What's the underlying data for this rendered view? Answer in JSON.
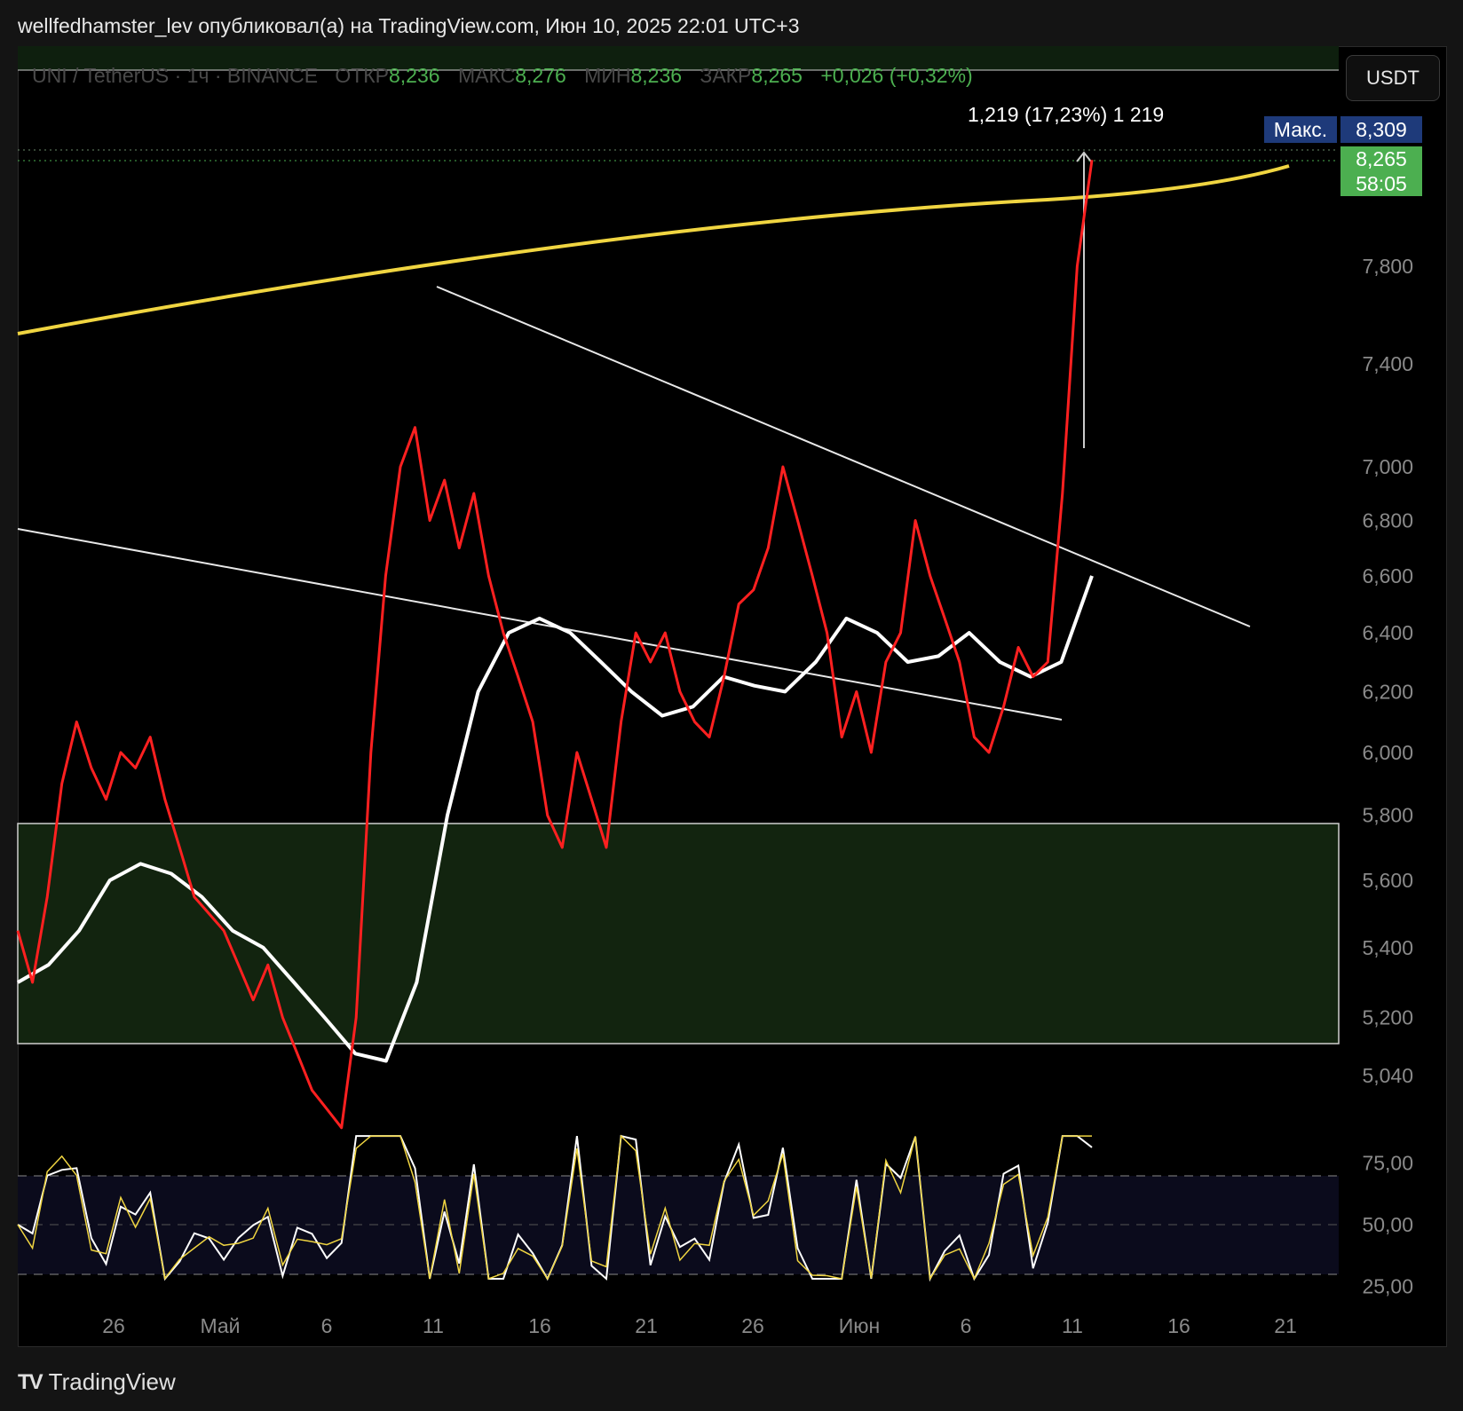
{
  "header": {
    "text": "wellfedhamster_lev опубликовал(а) на TradingView.com, Июн 10, 2025 22:01 UTC+3"
  },
  "legend": {
    "symbol": "UNI / TetherUS · 1ч · BINANCE",
    "open_label": "ОТКР",
    "open": "8,236",
    "high_label": "МАКС",
    "high": "8,276",
    "low_label": "МИН",
    "low": "8,236",
    "close_label": "ЗАКР",
    "close": "8,265",
    "change": "+0,026 (+0,32%)"
  },
  "currency_button": "USDT",
  "measure_label": "1,219 (17,23%) 1 219",
  "price_tags": {
    "max_label": "Макс.",
    "max_value": "8,309",
    "last_value": "8,265",
    "countdown": "58:05"
  },
  "footer": {
    "brand": "TradingView"
  },
  "colors": {
    "up": "#4caf50",
    "tag_blue": "#1e3a7a",
    "tag_green": "#4caf50",
    "yellow_line": "#f0d541",
    "fast_ma": "#ff2020",
    "slow_ma": "#ffffff"
  },
  "chart_data": {
    "type": "line",
    "price_axis": {
      "ticks": [
        "7,800",
        "7,400",
        "7,000",
        "6,800",
        "6,600",
        "6,400",
        "6,200",
        "6,000",
        "5,800",
        "5,600",
        "5,400",
        "5,200",
        "5,040"
      ],
      "scale": "log"
    },
    "rsi_axis": {
      "ticks": [
        "75,00",
        "50,00",
        "25,00"
      ],
      "band": [
        30,
        70
      ]
    },
    "x_ticks": [
      "26",
      "Май",
      "6",
      "11",
      "16",
      "21",
      "26",
      "Июн",
      "6",
      "11",
      "16",
      "21"
    ],
    "series": [
      {
        "values": [
          5.45,
          5.3,
          5.55,
          5.9,
          6.1,
          5.95,
          5.85,
          6.0,
          5.95,
          6.05,
          5.85,
          5.7,
          5.55,
          5.5,
          5.45,
          5.35,
          5.25,
          5.35,
          5.2,
          5.1,
          5.0,
          4.95,
          4.9,
          5.2,
          6.0,
          6.6,
          7.0,
          7.15,
          6.8,
          6.95,
          6.7,
          6.9,
          6.6,
          6.4,
          6.25,
          6.1,
          5.8,
          5.7,
          6.0,
          5.85,
          5.7,
          6.1,
          6.4,
          6.3,
          6.4,
          6.2,
          6.1,
          6.05,
          6.25,
          6.5,
          6.55,
          6.7,
          7.0,
          6.8,
          6.6,
          6.4,
          6.05,
          6.2,
          6.0,
          6.3,
          6.4,
          6.8,
          6.6,
          6.45,
          6.3,
          6.05,
          6.0,
          6.15,
          6.35,
          6.25,
          6.3,
          6.9,
          7.8,
          8.26
        ]
      },
      {
        "values": [
          5.3,
          5.35,
          5.45,
          5.6,
          5.65,
          5.62,
          5.55,
          5.45,
          5.4,
          5.3,
          5.2,
          5.1,
          5.08,
          5.3,
          5.8,
          6.2,
          6.4,
          6.45,
          6.4,
          6.3,
          6.2,
          6.12,
          6.15,
          6.25,
          6.22,
          6.2,
          6.3,
          6.45,
          6.4,
          6.3,
          6.32,
          6.4,
          6.3,
          6.25,
          6.3,
          6.6
        ]
      }
    ]
  }
}
